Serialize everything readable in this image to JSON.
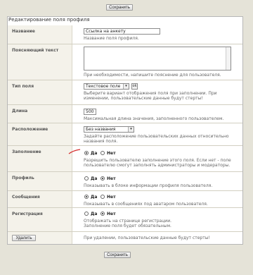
{
  "page": {
    "title": "Редактирование поля профиля",
    "save_top": "Сохранить",
    "save_bottom": "Сохранить"
  },
  "fields": {
    "name": {
      "label": "Название",
      "value": "Ссылка на анкету",
      "hint": "Название поля профиля."
    },
    "explain": {
      "label": "Поясняющий текст",
      "value": "",
      "hint": "При необходимости, напишите пояснение для пользователя."
    },
    "type": {
      "label": "Тип поля",
      "value": "Текстовое поле",
      "ok": "ok",
      "hint": "Выберите вариант отображения поля при заполнении. При изменении, пользовательские данные будут стерты!"
    },
    "length": {
      "label": "Длина",
      "value": "500",
      "hint": "Максимальная длина значения, заполненного пользователем."
    },
    "position": {
      "label": "Расположение",
      "value": "Без названия",
      "hint": "Задайте расположение пользовательских данных относительно названия поля."
    },
    "required": {
      "label": "Заполнение",
      "yes": "Да",
      "no": "Нет",
      "selected": "yes",
      "hint": "Разрешить пользователю заполнение этого поля. Если нет - поле пользователю смогут заполнять администраторы и модераторы."
    },
    "profile": {
      "label": "Профиль",
      "yes": "Да",
      "no": "Нет",
      "selected": "no",
      "hint": "Показывать в блоке информации профиля пользователя."
    },
    "messages": {
      "label": "Сообщения",
      "yes": "Да",
      "no": "Нет",
      "selected": "yes",
      "hint": "Показывать в сообщениях под аватаром пользователя."
    },
    "registration": {
      "label": "Регистрация",
      "yes": "Да",
      "no": "Нет",
      "selected": "no",
      "hint": "Отображать на странице регистрации. Заполнение поля будет обязательным."
    },
    "delete": {
      "button": "Удалить",
      "hint": "При удалении, пользовательские данные будут стерты!"
    }
  },
  "colors": {
    "background": "#e5e3d8",
    "label_bg": "#f4f2ea",
    "annotation": "#d62c2c"
  }
}
